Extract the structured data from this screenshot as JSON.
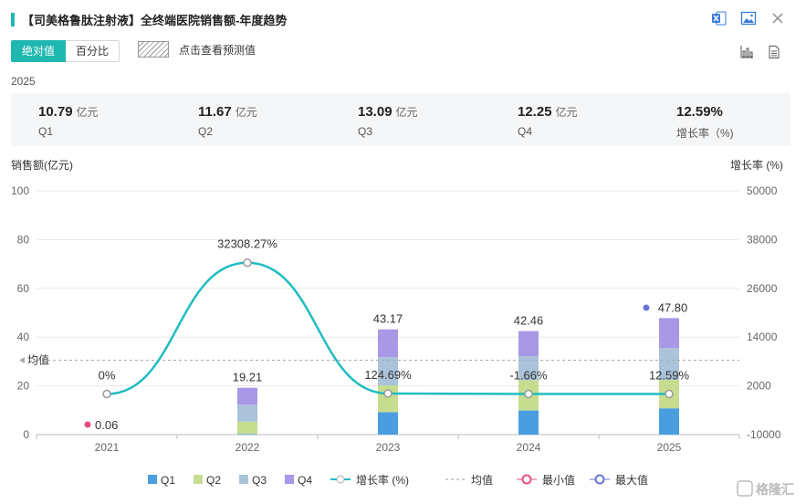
{
  "header": {
    "title": "【司美格鲁肽注射液】全终端医院销售额-年度趋势",
    "icons": [
      "excel-icon",
      "image-icon",
      "close-icon"
    ]
  },
  "tabs": [
    {
      "label": "绝对值",
      "active": true
    },
    {
      "label": "百分比",
      "active": false
    }
  ],
  "forecast": {
    "label": "点击查看预测值"
  },
  "view_icons": [
    "bar-chart-icon",
    "document-icon"
  ],
  "summary": {
    "year": "2025",
    "items": [
      {
        "value": "10.79",
        "unit": "亿元",
        "label": "Q1"
      },
      {
        "value": "11.67",
        "unit": "亿元",
        "label": "Q2"
      },
      {
        "value": "13.09",
        "unit": "亿元",
        "label": "Q3"
      },
      {
        "value": "12.25",
        "unit": "亿元",
        "label": "Q4"
      },
      {
        "value": "12.59%",
        "unit": "",
        "label": "增长率（%)"
      }
    ]
  },
  "colors": {
    "accent": "#1fb8b0",
    "Q1": "#4a9ee0",
    "Q2": "#c6dd8f",
    "Q3": "#aac3da",
    "Q4": "#a898e5",
    "growth_line": "#1fbdc1",
    "min_marker": "#ea4c7d",
    "max_marker": "#6b75d6"
  },
  "chart_data": {
    "type": "bar",
    "stacked": true,
    "categories": [
      "2021",
      "2022",
      "2023",
      "2024",
      "2025"
    ],
    "ylabel": "销售额(亿元)",
    "y2label": "增长率  (%)",
    "ylim": [
      0,
      100
    ],
    "yticks": [
      0,
      20,
      40,
      60,
      80,
      100
    ],
    "y2lim": [
      -10000,
      50000
    ],
    "y2ticks": [
      -10000,
      2000,
      14000,
      26000,
      38000,
      50000
    ],
    "series": [
      {
        "name": "Q1",
        "values": [
          0.0,
          0.3,
          9.2,
          9.9,
          10.79
        ]
      },
      {
        "name": "Q2",
        "values": [
          0.0,
          5.0,
          11.0,
          12.4,
          11.67
        ]
      },
      {
        "name": "Q3",
        "values": [
          0.0,
          7.0,
          11.6,
          9.9,
          13.09
        ]
      },
      {
        "name": "Q4",
        "values": [
          0.06,
          6.91,
          11.37,
          10.26,
          12.25
        ]
      }
    ],
    "totals": [
      "0.06",
      "19.21",
      "43.17",
      "42.46",
      "47.80"
    ],
    "growth": {
      "name": "增长率  (%)",
      "values": [
        0,
        32308.27,
        124.69,
        -1.66,
        12.59
      ],
      "labels": [
        "0%",
        "32308.27%",
        "124.69%",
        "-1.66%",
        "12.59%"
      ]
    },
    "average": {
      "name": "均值",
      "label": "均值",
      "value": 30.54
    },
    "min": {
      "name": "最小值",
      "category": "2021",
      "value": 0.06
    },
    "max": {
      "name": "最大值",
      "category": "2025",
      "value": 47.8
    },
    "legend": [
      "Q1",
      "Q2",
      "Q3",
      "Q4",
      "增长率  (%)",
      "均值",
      "最小值",
      "最大值"
    ],
    "legend_position": "bottom",
    "grid": true
  },
  "watermark": "格隆汇"
}
